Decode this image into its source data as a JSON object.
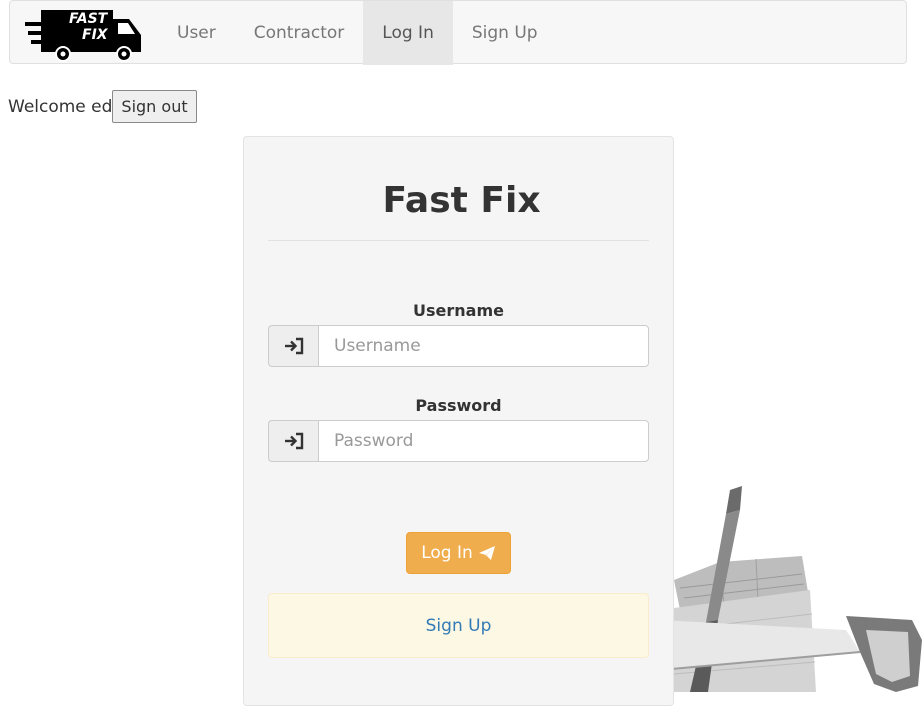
{
  "nav": {
    "brand": {
      "line1": "FAST",
      "line2": "FIX"
    },
    "links": [
      {
        "label": "User",
        "active": false
      },
      {
        "label": "Contractor",
        "active": false
      },
      {
        "label": "Log In",
        "active": true
      },
      {
        "label": "Sign Up",
        "active": false
      }
    ]
  },
  "session": {
    "welcome_text": "Welcome ed",
    "signout_label": "Sign out"
  },
  "login_form": {
    "title": "Fast Fix",
    "username": {
      "label": "Username",
      "placeholder": "Username",
      "value": "",
      "icon": "log-in-icon"
    },
    "password": {
      "label": "Password",
      "placeholder": "Password",
      "value": "",
      "icon": "log-in-icon"
    },
    "submit_label": "Log In",
    "submit_icon": "send-icon",
    "signup_label": "Sign Up"
  },
  "colors": {
    "primary_warning": "#f0ad4e",
    "link": "#337ab7",
    "signup_panel_bg": "#fcf8e3",
    "navbar_bg": "#f7f7f7",
    "nav_active_bg": "#e7e7e7"
  }
}
